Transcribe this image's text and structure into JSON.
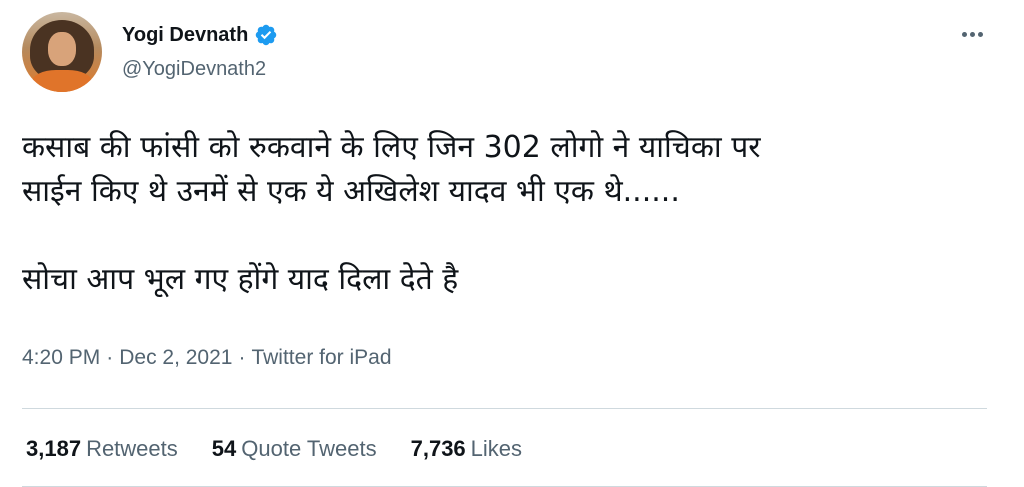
{
  "author": {
    "display_name": "Yogi Devnath",
    "handle": "@YogiDevnath2",
    "verified": true,
    "avatar_icon": "profile-photo"
  },
  "tweet": {
    "lines": [
      "कसाब की फांसी को रुकवाने के लिए जिन 302 लोगो ने याचिका पर",
      "साईन किए थे उनमें से एक ये अखिलेश यादव भी एक थे......",
      "सोचा आप भूल गए होंगे याद दिला देते है"
    ],
    "time": "4:20 PM",
    "date": "Dec 2, 2021",
    "source": "Twitter for iPad",
    "separator": "·"
  },
  "stats": {
    "retweets": {
      "count": "3,187",
      "label": "Retweets"
    },
    "quotes": {
      "count": "54",
      "label": "Quote Tweets"
    },
    "likes": {
      "count": "7,736",
      "label": "Likes"
    }
  },
  "colors": {
    "verified_badge": "#1d9bf0",
    "secondary_text": "#536471",
    "primary_text": "#0f1419"
  },
  "icons": {
    "more": "more-horizontal-icon",
    "verified": "verified-badge-icon"
  }
}
